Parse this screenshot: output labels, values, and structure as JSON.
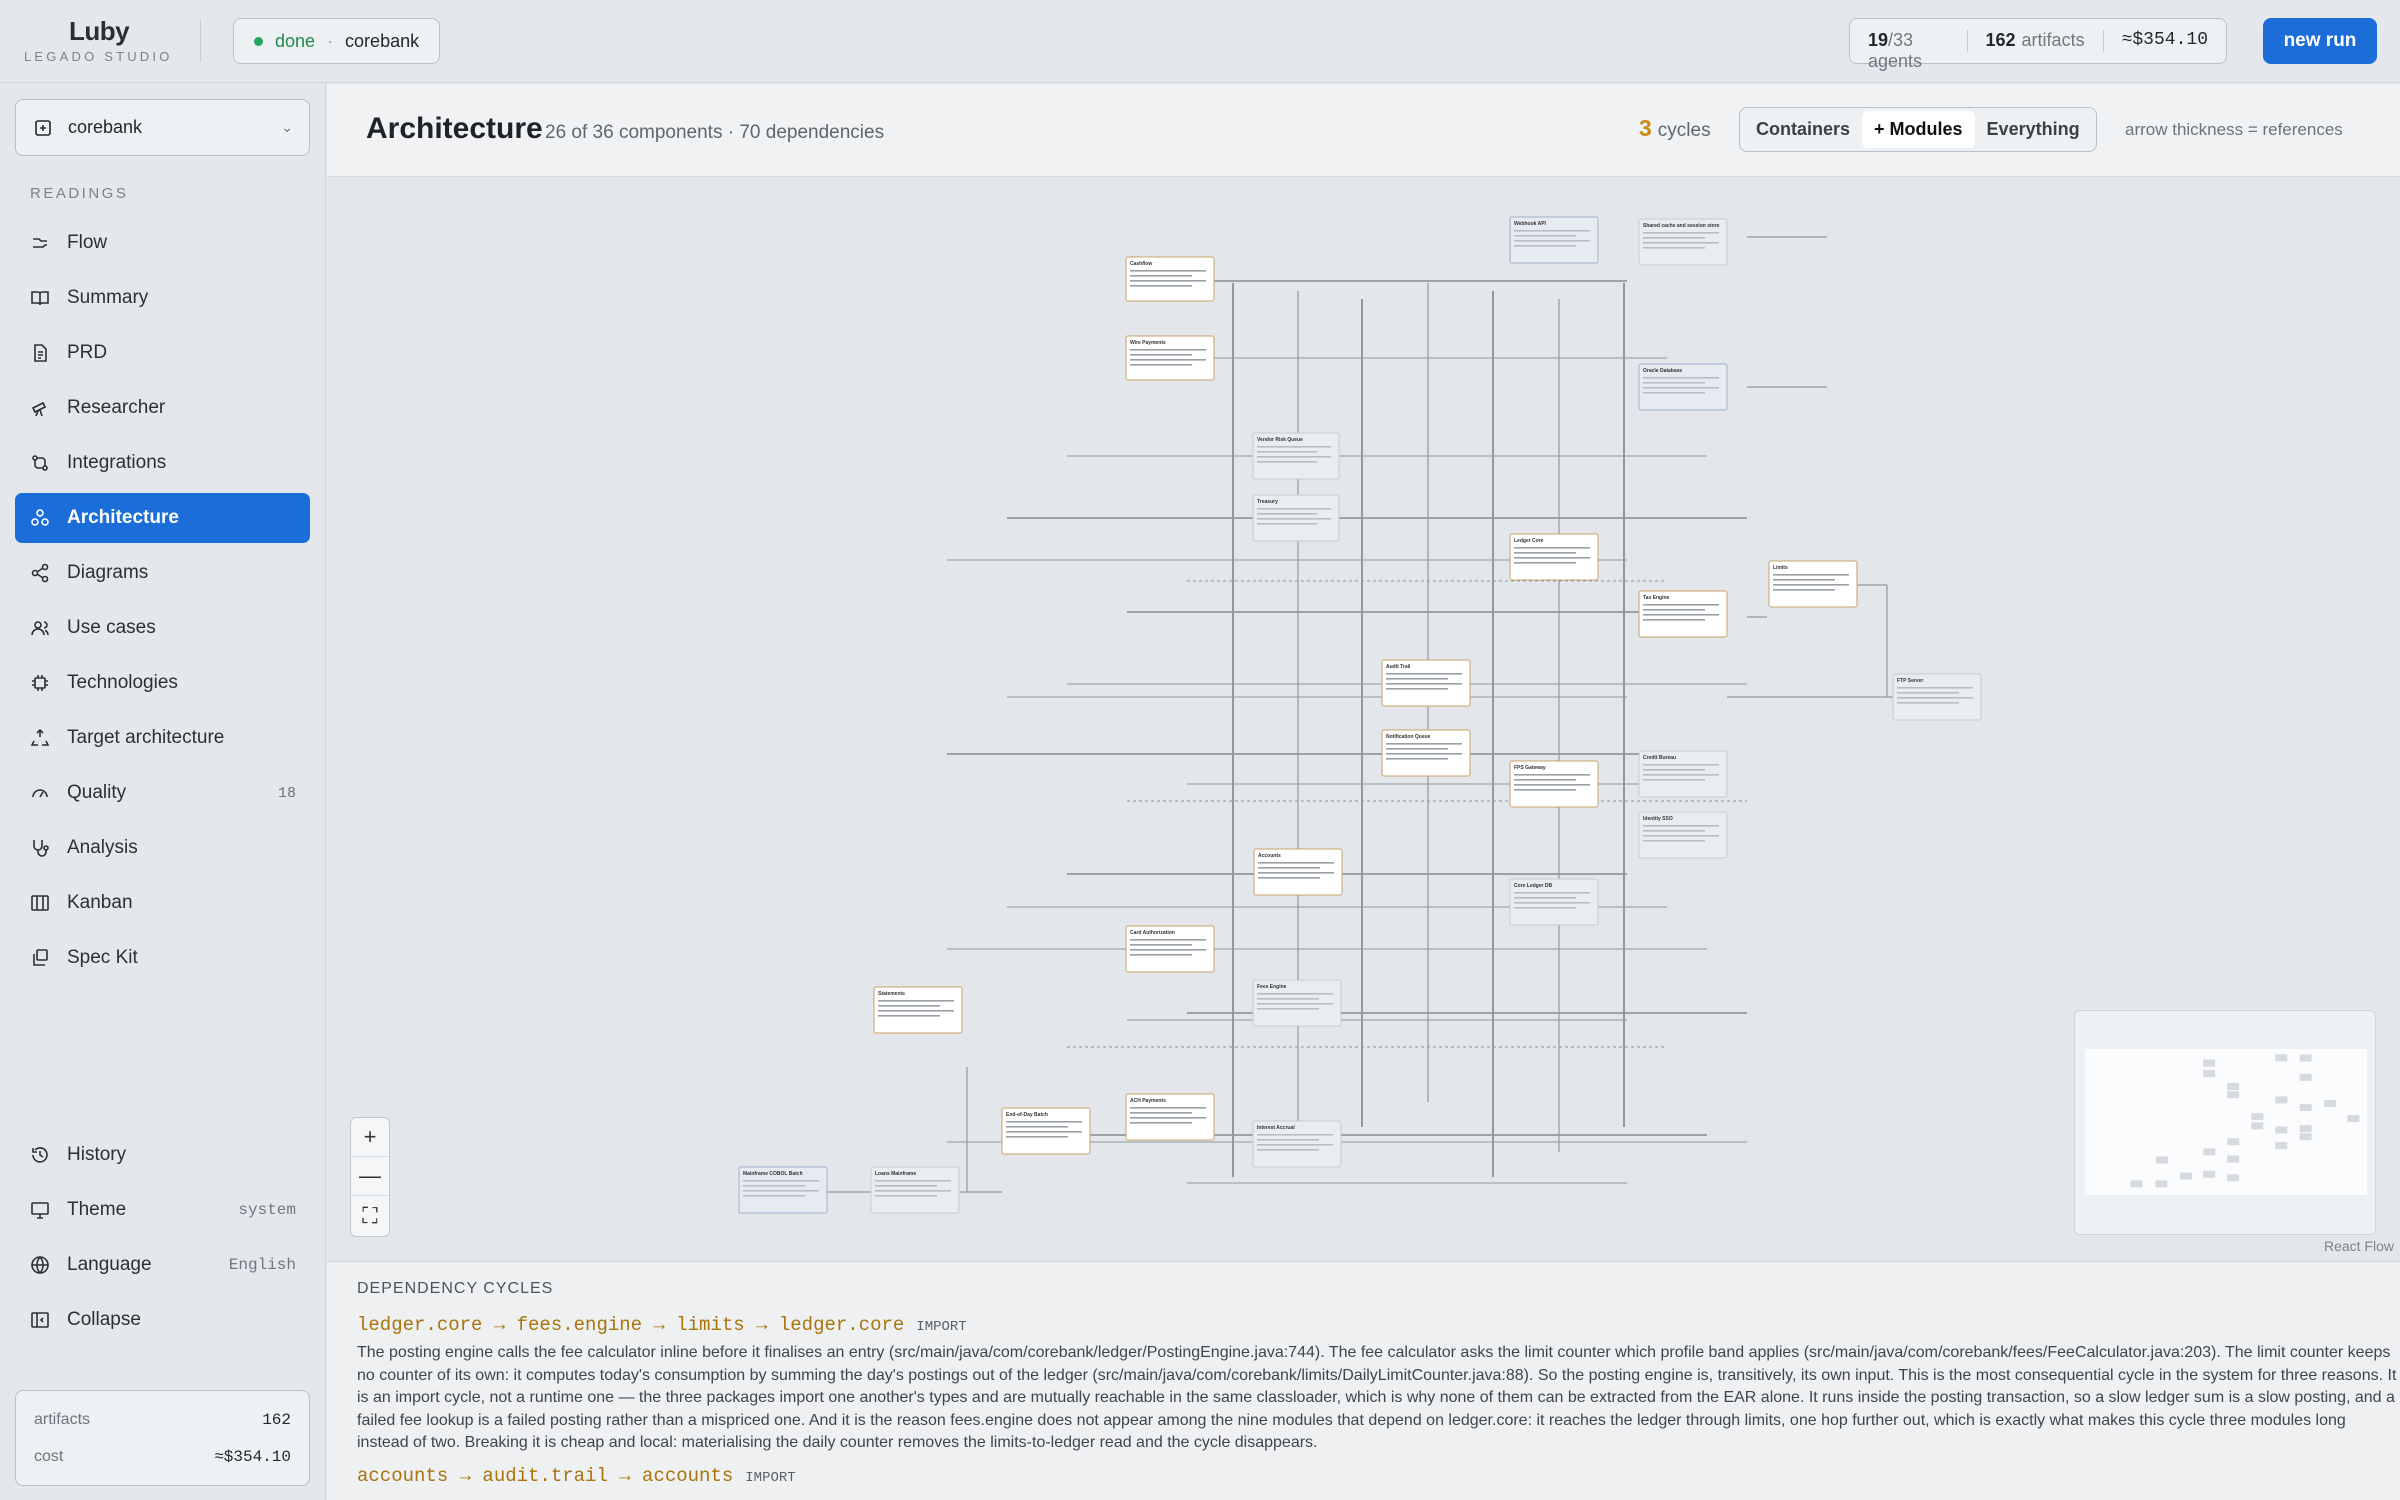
{
  "app": {
    "logo": "Luby",
    "studio": "LEGADO STUDIO",
    "status": "done",
    "status_sep": "·",
    "project": "corebank",
    "agents_done": "19",
    "agents_total": "/33 agents",
    "artifacts_count": "162",
    "artifacts_label": "artifacts",
    "cost": "≈$354.10",
    "new_run": "new run"
  },
  "sidebar": {
    "project_selector": "corebank",
    "section_label": "READINGS",
    "items": [
      {
        "label": "Flow",
        "icon": "flow-icon"
      },
      {
        "label": "Summary",
        "icon": "book-icon"
      },
      {
        "label": "PRD",
        "icon": "document-icon"
      },
      {
        "label": "Researcher",
        "icon": "telescope-icon"
      },
      {
        "label": "Integrations",
        "icon": "integrations-icon"
      },
      {
        "label": "Architecture",
        "icon": "architecture-icon",
        "active": true
      },
      {
        "label": "Diagrams",
        "icon": "share-icon"
      },
      {
        "label": "Use cases",
        "icon": "users-icon"
      },
      {
        "label": "Technologies",
        "icon": "chip-icon"
      },
      {
        "label": "Target architecture",
        "icon": "recycle-icon"
      },
      {
        "label": "Quality",
        "icon": "gauge-icon",
        "badge": "18"
      },
      {
        "label": "Analysis",
        "icon": "stethoscope-icon"
      },
      {
        "label": "Kanban",
        "icon": "kanban-icon"
      },
      {
        "label": "Spec Kit",
        "icon": "speckit-icon"
      }
    ],
    "bottom": [
      {
        "label": "History",
        "icon": "history-icon",
        "value": ""
      },
      {
        "label": "Theme",
        "icon": "monitor-icon",
        "value": "system"
      },
      {
        "label": "Language",
        "icon": "globe-icon",
        "value": "English"
      },
      {
        "label": "Collapse",
        "icon": "collapse-icon",
        "value": ""
      }
    ],
    "footer": {
      "artifacts_label": "artifacts",
      "artifacts_value": "162",
      "cost_label": "cost",
      "cost_value": "≈$354.10"
    }
  },
  "header": {
    "title": "Architecture",
    "subtitle": "26 of 36 components · 70 dependencies",
    "cycles_count": "3",
    "cycles_label": "cycles",
    "view_options": [
      "Containers",
      "+ Modules",
      "Everything"
    ],
    "view_selected": "+ Modules",
    "arrow_note": "arrow thickness = references"
  },
  "graph": {
    "nodes": [
      {
        "name": "Cashflow"
      },
      {
        "name": "Wire Payments"
      },
      {
        "name": "Vendor Risk Queue"
      },
      {
        "name": "Treasury"
      },
      {
        "name": "Ledger Core"
      },
      {
        "name": "Tax Engine"
      },
      {
        "name": "Limits"
      },
      {
        "name": "Audit Trail"
      },
      {
        "name": "Notification Queue"
      },
      {
        "name": "FPS Gateway"
      },
      {
        "name": "Accounts"
      },
      {
        "name": "Card Authorization"
      },
      {
        "name": "Statements"
      },
      {
        "name": "End-of-Day Batch"
      },
      {
        "name": "ACH Payments"
      },
      {
        "name": "Loans Mainframe"
      },
      {
        "name": "Fees Engine"
      },
      {
        "name": "Interest Accrual"
      },
      {
        "name": "Mainframe COBOL Batch"
      },
      {
        "name": "Webhook API"
      },
      {
        "name": "Shared cache and session store"
      },
      {
        "name": "Oracle Database"
      },
      {
        "name": "FTP Server"
      },
      {
        "name": "Credit Bureau"
      },
      {
        "name": "Identity SSO"
      },
      {
        "name": "Core Ledger DB"
      }
    ],
    "zoom_in": "+",
    "zoom_out": "—",
    "fit": "⛶",
    "attribution": "React Flow"
  },
  "cycles_panel": {
    "title": "DEPENDENCY CYCLES",
    "cycles": [
      {
        "path": "ledger.core → fees.engine → limits → ledger.core",
        "kind": "IMPORT",
        "description": "The posting engine calls the fee calculator inline before it finalises an entry (src/main/java/com/corebank/ledger/PostingEngine.java:744). The fee calculator asks the limit counter which profile band applies (src/main/java/com/corebank/fees/FeeCalculator.java:203). The limit counter keeps no counter of its own: it computes today's consumption by summing the day's postings out of the ledger (src/main/java/com/corebank/limits/DailyLimitCounter.java:88). So the posting engine is, transitively, its own input. This is the most consequential cycle in the system for three reasons. It is an import cycle, not a runtime one — the three packages import one another's types and are mutually reachable in the same classloader, which is why none of them can be extracted from the EAR alone. It runs inside the posting transaction, so a slow ledger sum is a slow posting, and a failed fee lookup is a failed posting rather than a mispriced one. And it is the reason fees.engine does not appear among the nine modules that depend on ledger.core: it reaches the ledger through limits, one hop further out, which is exactly what makes this cycle three modules long instead of two. Breaking it is cheap and local: materialising the daily counter removes the limits-to-ledger read and the cycle disappears."
      },
      {
        "path": "accounts → audit.trail → accounts",
        "kind": "IMPORT",
        "description": ""
      }
    ]
  }
}
